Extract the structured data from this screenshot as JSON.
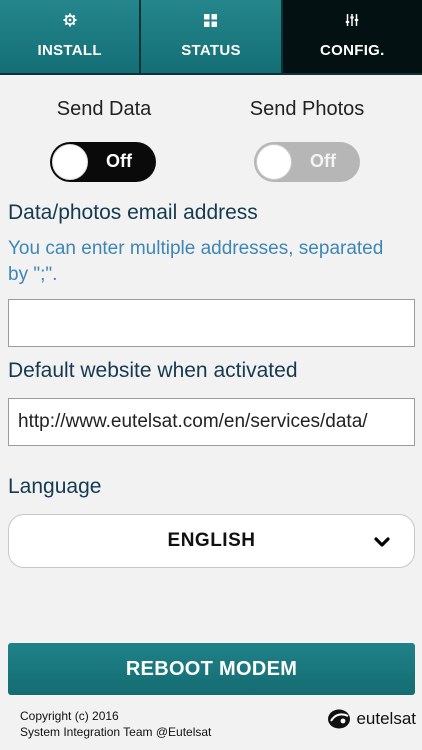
{
  "tabs": [
    {
      "label": "INSTALL",
      "icon": "gear-icon",
      "active": false
    },
    {
      "label": "STATUS",
      "icon": "grid-icon",
      "active": false
    },
    {
      "label": "CONFIG.",
      "icon": "sliders-icon",
      "active": true
    }
  ],
  "toggles": {
    "send_data": {
      "label": "Send Data",
      "state": "Off",
      "enabled": true
    },
    "send_photos": {
      "label": "Send Photos",
      "state": "Off",
      "enabled": false
    }
  },
  "email": {
    "heading": "Data/photos email address",
    "note": "You can enter multiple addresses, separated by \";\".",
    "value": ""
  },
  "website": {
    "heading": "Default website when activated",
    "value": "http://www.eutelsat.com/en/services/data/"
  },
  "language": {
    "heading": "Language",
    "selected": "ENGLISH"
  },
  "reboot_label": "REBOOT MODEM",
  "footer": {
    "line1": "Copyright (c) 2016",
    "line2": "System Integration Team @Eutelsat",
    "brand": "eutelsat"
  },
  "colors": {
    "accent": "#1c7a80",
    "active_tab": "#031112",
    "note_blue": "#3d86b6",
    "heading_navy": "#153a50"
  }
}
